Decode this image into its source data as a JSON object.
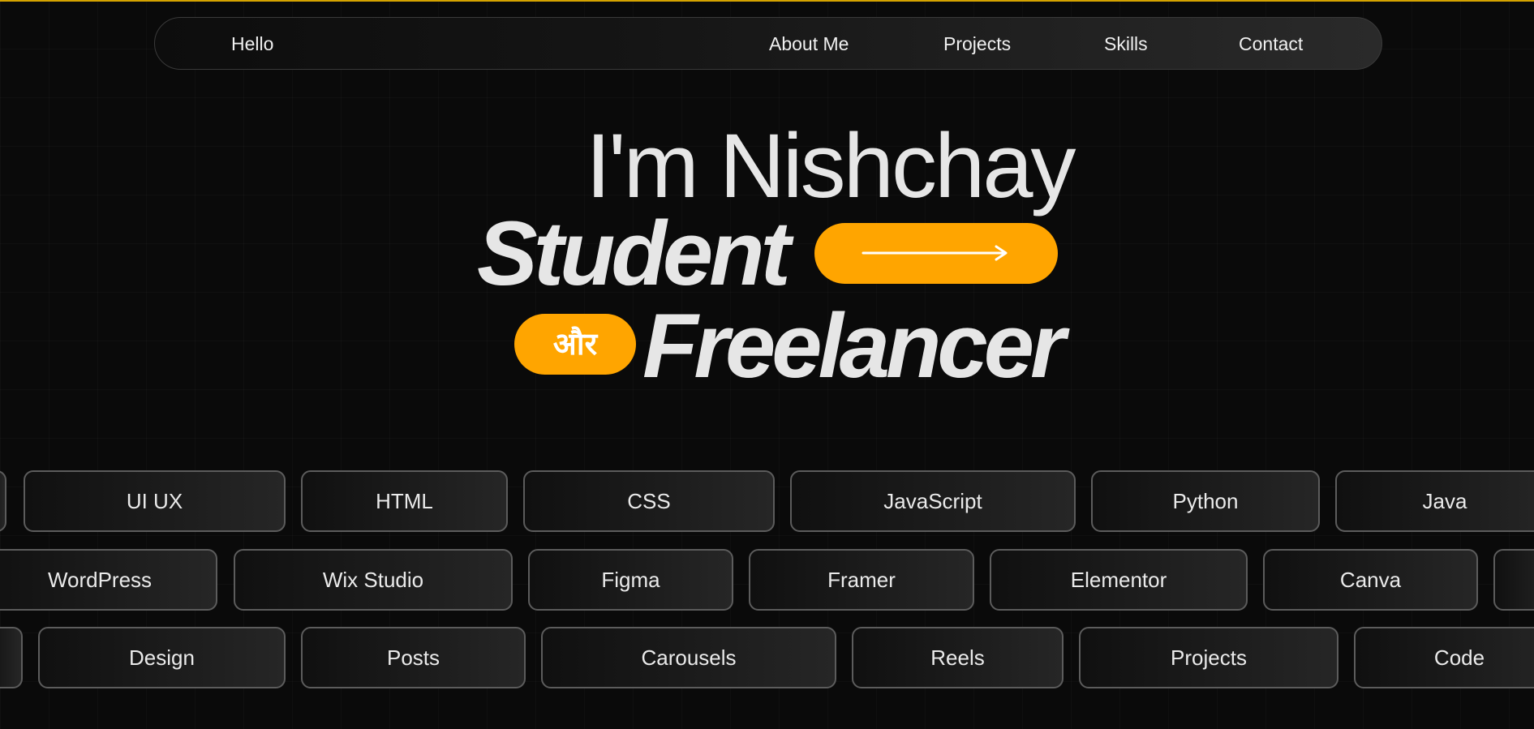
{
  "colors": {
    "accent": "#ffa500",
    "background": "#0a0a0a",
    "top_border": "#d4a300",
    "text": "#e6e6e6"
  },
  "nav": {
    "brand": "Hello",
    "links": [
      "About Me",
      "Projects",
      "Skills",
      "Contact"
    ]
  },
  "hero": {
    "line1": "I'm Nishchay",
    "line2": "Student",
    "connector": "और",
    "line3": "Freelancer",
    "arrow_icon": "arrow-right-icon"
  },
  "tags": {
    "row1": [
      "",
      "UI UX",
      "HTML",
      "CSS",
      "JavaScript",
      "Python",
      "Java"
    ],
    "row2": [
      "WordPress",
      "Wix Studio",
      "Figma",
      "Framer",
      "Elementor",
      "Canva",
      ""
    ],
    "row3": [
      "",
      "Design",
      "Posts",
      "Carousels",
      "Reels",
      "Projects",
      "Code"
    ]
  }
}
